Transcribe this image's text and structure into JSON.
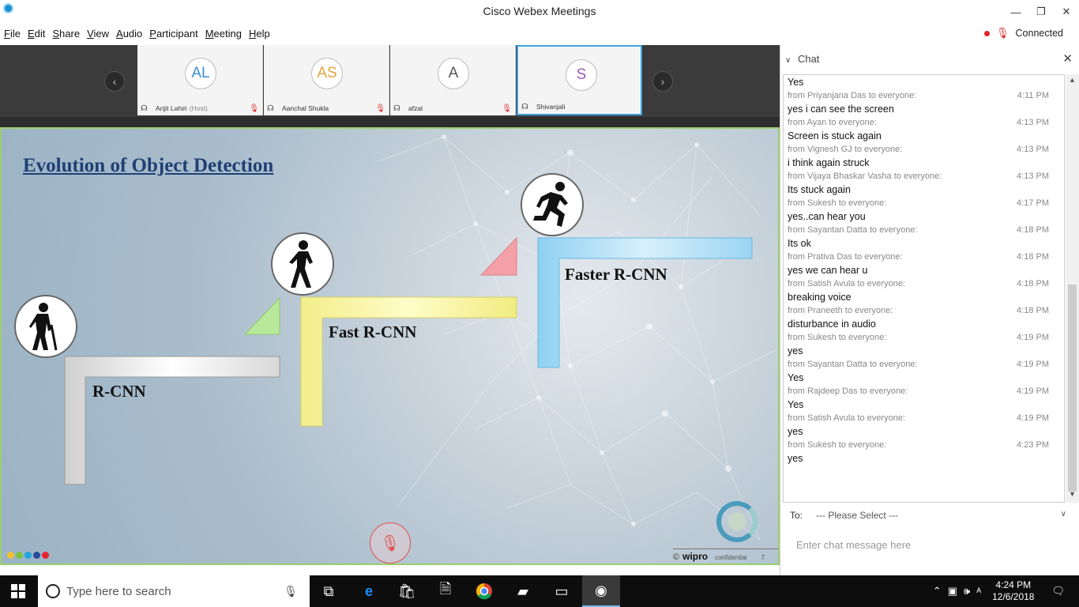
{
  "window": {
    "title": "Cisco Webex Meetings",
    "minimize": "—",
    "maximize": "❐",
    "close": "✕"
  },
  "menu": [
    "File",
    "Edit",
    "Share",
    "View",
    "Audio",
    "Participant",
    "Meeting",
    "Help"
  ],
  "status": {
    "connection": "Connected",
    "recording_color": "#e02424"
  },
  "participants": [
    {
      "initials": "AL",
      "name": "Arijit Lahiri",
      "role": "(Host)",
      "color": "#3a8fd0",
      "muted": true
    },
    {
      "initials": "AS",
      "name": "Aanchal Shukla",
      "role": "",
      "color": "#e6a23c",
      "muted": true
    },
    {
      "initials": "A",
      "name": "afzal",
      "role": "",
      "color": "#555555",
      "muted": true
    },
    {
      "initials": "S",
      "name": "Shivanjali",
      "role": "",
      "color": "#9b59b6",
      "muted": false
    }
  ],
  "nav": {
    "prev": "‹",
    "next": "›"
  },
  "slide": {
    "title": "Evolution of Object Detection",
    "steps": [
      "R-CNN",
      "Fast R-CNN",
      "Faster R-CNN"
    ],
    "footer_brand": "wipro",
    "footer_copy": "©",
    "footer_confidential": "confidential",
    "footer_page": "7",
    "footer_dot_colors": [
      "#f2c12e",
      "#7cc142",
      "#1ea7e1",
      "#2a4b9b",
      "#e3262e"
    ]
  },
  "chat": {
    "header": "Chat",
    "first_text": "Yes",
    "messages": [
      {
        "from": "from Priyanjana Das to everyone:",
        "time": "4:11 PM",
        "text": "yes i can see the screen"
      },
      {
        "from": "from Ayan to everyone:",
        "time": "4:13 PM",
        "text": "Screen is stuck again"
      },
      {
        "from": "from Vignesh GJ to everyone:",
        "time": "4:13 PM",
        "text": "i think again struck"
      },
      {
        "from": "from Vijaya Bhaskar Vasha to everyone:",
        "time": "4:13 PM",
        "text": "Its stuck again"
      },
      {
        "from": "from Sukesh to everyone:",
        "time": "4:17 PM",
        "text": "yes..can hear you"
      },
      {
        "from": "from Sayantan Datta to everyone:",
        "time": "4:18 PM",
        "text": "Its ok"
      },
      {
        "from": "from Prativa Das to everyone:",
        "time": "4:18 PM",
        "text": "yes we can hear u"
      },
      {
        "from": "from Satish Avula to everyone:",
        "time": "4:18 PM",
        "text": "breaking voice"
      },
      {
        "from": "from Praneeth to everyone:",
        "time": "4:18 PM",
        "text": "disturbance in audio"
      },
      {
        "from": "from Sukesh to everyone:",
        "time": "4:19 PM",
        "text": "yes"
      },
      {
        "from": "from Sayantan Datta to everyone:",
        "time": "4:19 PM",
        "text": "Yes"
      },
      {
        "from": "from Rajdeep Das to everyone:",
        "time": "4:19 PM",
        "text": "Yes"
      },
      {
        "from": "from Satish Avula to everyone:",
        "time": "4:19 PM",
        "text": "yes"
      },
      {
        "from": "from Sukesh to everyone:",
        "time": "4:23 PM",
        "text": "yes"
      }
    ],
    "to_label": "To:",
    "to_value": "--- Please Select ---",
    "input_placeholder": "Enter chat message here"
  },
  "taskbar": {
    "search_placeholder": "Type here to search",
    "time": "4:24 PM",
    "date": "12/6/2018",
    "apps": [
      "task-view",
      "edge",
      "store",
      "file",
      "chrome",
      "notes",
      "cmd",
      "webex"
    ]
  }
}
